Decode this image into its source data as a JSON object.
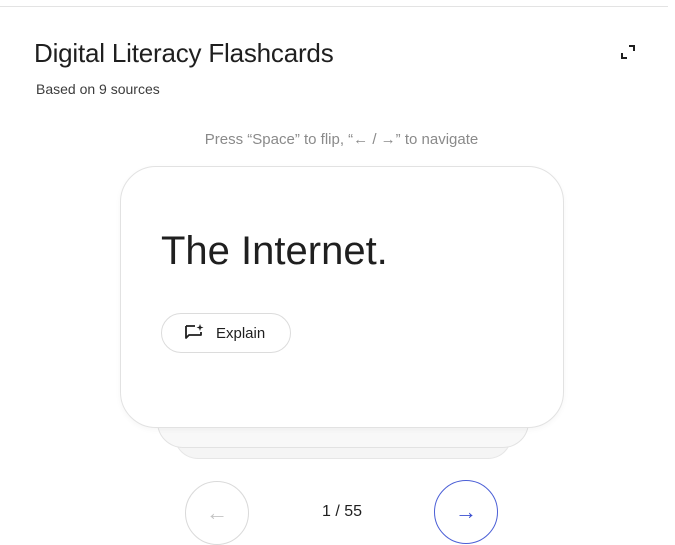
{
  "header": {
    "title": "Digital Literacy Flashcards",
    "subtitle": "Based on 9 sources",
    "expand_icon": "expand-icon"
  },
  "hint": "Press “Space” to flip, “← / →” to navigate",
  "card": {
    "text": "The Internet.",
    "explain_label": "Explain",
    "explain_icon": "sparkle-comment-icon"
  },
  "nav": {
    "prev_icon": "arrow-left-icon",
    "next_icon": "arrow-right-icon",
    "prev_glyph": "←",
    "next_glyph": "→",
    "counter": "1 / 55",
    "next_color": "#3b4fd0"
  }
}
